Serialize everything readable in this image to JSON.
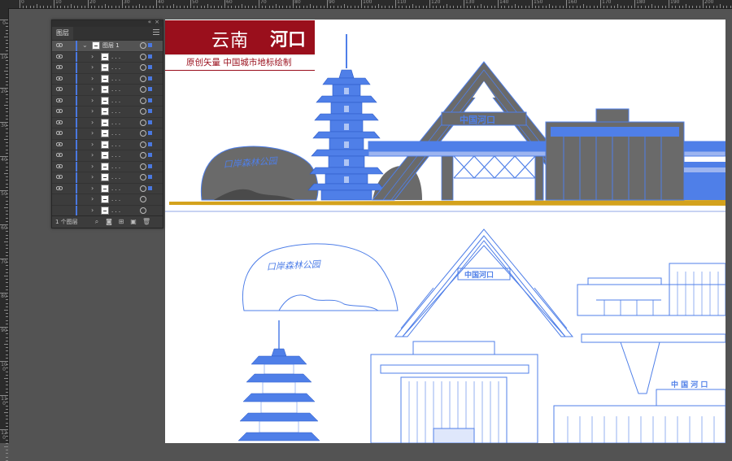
{
  "rulers": {
    "top_labels": [
      "0",
      "10",
      "20",
      "30",
      "40",
      "50",
      "60",
      "70",
      "80",
      "90",
      "100",
      "110",
      "120",
      "130",
      "140",
      "150",
      "160",
      "170",
      "180",
      "190",
      "200"
    ],
    "left_labels": [
      "0",
      "10",
      "20",
      "30",
      "40",
      "50",
      "60",
      "70",
      "80",
      "90",
      "100",
      "110",
      "120",
      "130",
      "140",
      "150",
      "160",
      "170",
      "180",
      "190",
      "200"
    ]
  },
  "layers_panel": {
    "tab_label": "图层",
    "parent_layer": {
      "name": "图层 1"
    },
    "sublayer_label": ". . .",
    "sublayer_count": 15,
    "footer_count": "1 个图层",
    "accent_color": "#4a78e0"
  },
  "banner": {
    "province": "云南",
    "city": "河口",
    "subtitle": "原创矢量 中国城市地标绘制",
    "color": "#9a0f1c"
  },
  "artwork": {
    "gate_sign_text": "中国河口",
    "rock_inscription": "口岸森林公园",
    "station_sign_text": "中 国 河 口",
    "fill_color": "#4f7fe8",
    "gray_color": "#6a6a6a",
    "ground_color": "#d4a21c"
  }
}
